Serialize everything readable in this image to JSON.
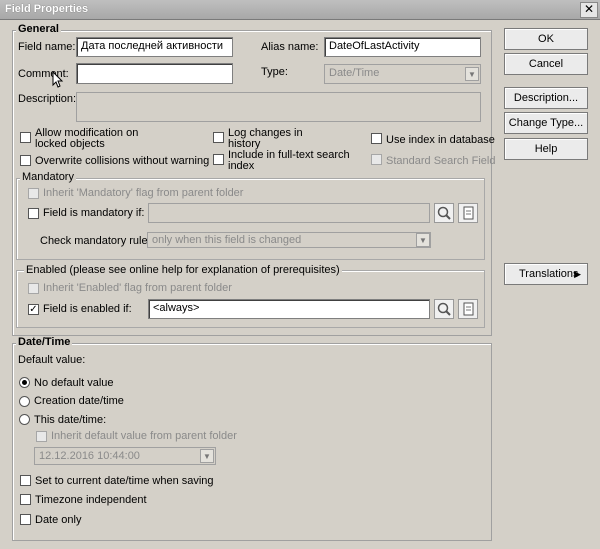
{
  "window": {
    "title": "Field Properties"
  },
  "general": {
    "title": "General",
    "field_name_label": "Field name:",
    "field_name_value": "Дата последней активности",
    "alias_label": "Alias name:",
    "alias_value": "DateOfLastActivity",
    "comment_label": "Comment:",
    "comment_value": "",
    "type_label": "Type:",
    "type_value": "Date/Time",
    "description_label": "Description:",
    "description_value": "",
    "allow_modification": "Allow modification on locked objects",
    "log_changes": "Log changes in history",
    "use_index": "Use index in database",
    "overwrite_collisions": "Overwrite collisions without warning",
    "fulltext": "Include in full-text search index",
    "standard_search": "Standard Search Field",
    "mandatory": {
      "title": "Mandatory",
      "inherit": "Inherit 'Mandatory' flag from parent folder",
      "field_mandatory_if": "Field is mandatory if:",
      "mandatory_if_value": "",
      "check_rule_label": "Check mandatory rule:",
      "check_rule_value": "only when this field is changed"
    },
    "enabled": {
      "title": "Enabled (please see online help for explanation of prerequisites)",
      "inherit": "Inherit 'Enabled' flag from parent folder",
      "field_enabled_if": "Field is enabled if:",
      "enabled_if_value": "<always>",
      "field_enabled_checked": true
    }
  },
  "datetime": {
    "title": "Date/Time",
    "default_label": "Default value:",
    "no_default": "No default value",
    "creation": "Creation date/time",
    "this_date": "This date/time:",
    "inherit_default": "Inherit default value from parent folder",
    "date_value": "12.12.2016 10:44:00",
    "set_current": "Set to current date/time when saving",
    "timezone": "Timezone independent",
    "date_only": "Date only",
    "selected": "No default value"
  },
  "buttons": {
    "ok": "OK",
    "cancel": "Cancel",
    "description": "Description...",
    "change_type": "Change Type...",
    "help": "Help",
    "translations": "Translations"
  }
}
